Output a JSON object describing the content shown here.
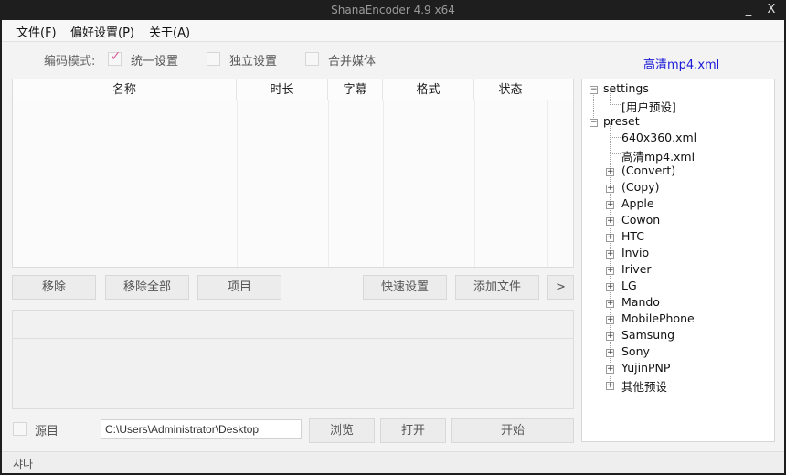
{
  "window": {
    "title": "ShanaEncoder 4.9 x64",
    "minimize": "_",
    "close": "X"
  },
  "menu": {
    "items": [
      "文件(F)",
      "偏好设置(P)",
      "关于(A)"
    ]
  },
  "mode": {
    "label": "编码模式:",
    "unified": {
      "label": "统一设置",
      "checked": true,
      "check_mark": "✓"
    },
    "independent": {
      "label": "独立设置",
      "checked": false
    },
    "merge": {
      "label": "合并媒体",
      "checked": false
    }
  },
  "current_preset": "高清mp4.xml",
  "file_list": {
    "columns": [
      "名称",
      "时长",
      "字幕",
      "格式",
      "状态"
    ],
    "rows": []
  },
  "buttons": {
    "remove": "移除",
    "remove_all": "移除全部",
    "item": "项目",
    "quick_settings": "快速设置",
    "add_file": "添加文件",
    "more": ">",
    "browse": "浏览",
    "open": "打开",
    "start": "开始"
  },
  "output": {
    "source_label": "源目",
    "source_checked": false,
    "path": "C:\\Users\\Administrator\\Desktop"
  },
  "status": "샤나",
  "tree": {
    "settings": {
      "label": "settings",
      "expand": "−",
      "children": [
        "[用户预设]"
      ]
    },
    "preset": {
      "label": "preset",
      "expand": "−",
      "files": [
        "640x360.xml",
        "高清mp4.xml"
      ],
      "folders": [
        "(Convert)",
        "(Copy)",
        "Apple",
        "Cowon",
        "HTC",
        "Invio",
        "Iriver",
        "LG",
        "Mando",
        "MobilePhone",
        "Samsung",
        "Sony",
        "YujinPNP",
        "其他预设"
      ],
      "folder_expand": "+"
    }
  }
}
